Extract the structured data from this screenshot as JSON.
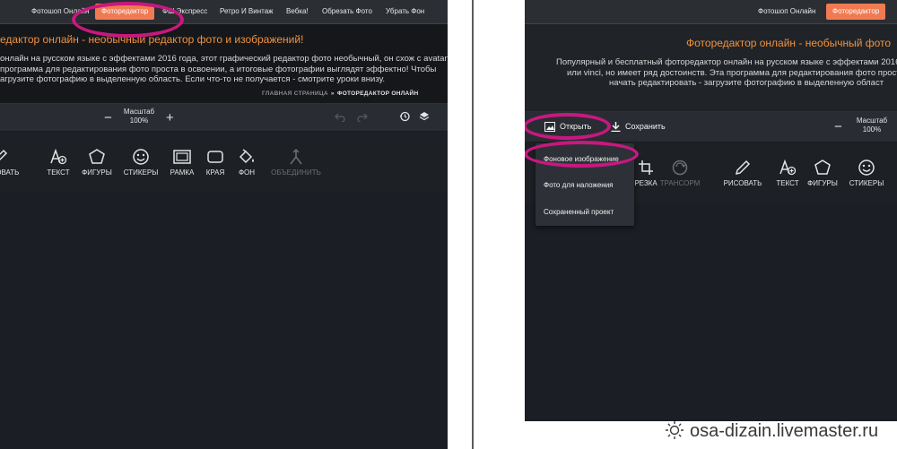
{
  "left": {
    "nav": [
      "Фотошоп Онлайн",
      "Фоторедактор",
      "ФШ Экспресс",
      "Ретро И Винтаж",
      "Вебка!",
      "Обрезать Фото",
      "Убрать Фон"
    ],
    "hero": {
      "title": "едактор онлайн - необычный редактор фото и изображений!",
      "lines": [
        "онлайн на русском языке с эффектами 2016 года, этот графический редактор фото необычный, он схож с avatan",
        "программа для редактирования фото проста в освоении, а итоговые фотографии выглядят эффектно! Чтобы",
        "агрузите фотографию в выделенную область. Если что-то не получается - смотрите уроки внизу."
      ],
      "crumb_home": "ГЛАВНАЯ СТРАНИЦА",
      "crumb_sep": "»",
      "crumb_current": "ФОТОРЕДАКТОР ОНЛАЙН"
    },
    "toolbar": {
      "zoom_title": "Масштаб",
      "zoom_value": "100%",
      "minus": "−",
      "plus": "+"
    },
    "tools": [
      "РИСОВАТЬ",
      "ТЕКСТ",
      "ФИГУРЫ",
      "СТИКЕРЫ",
      "РАМКА",
      "КРАЯ",
      "ФОН",
      "ОБЪЕДИНИТЬ"
    ]
  },
  "right": {
    "nav": [
      "Фотошоп Онлайн",
      "Фоторедактор"
    ],
    "hero": {
      "title": "Фоторедактор онлайн - необычный фото",
      "lines": [
        "Популярный и бесплатный фоторедактор онлайн на русском языке с эффектами 2016",
        "или vinci, но имеет ряд достоинств. Эта программа для редактирования фото проста",
        "начать редактировать - загрузите фотографию в выделенную област"
      ]
    },
    "toolbar": {
      "open": "Открыть",
      "save": "Сохранить",
      "zoom_title": "Масштаб",
      "zoom_value": "100%",
      "minus": "−"
    },
    "tools": [
      "РЕЗКА",
      "ТРАНСОРМ",
      "РИСОВАТЬ",
      "ТЕКСТ",
      "ФИГУРЫ",
      "СТИКЕРЫ"
    ],
    "dropdown": [
      "Фоновое изображение",
      "Фото для наложения",
      "Сохраненный проект"
    ]
  },
  "watermark": "osa-dizain.livemaster.ru",
  "colors": {
    "accent": "#f07a52",
    "title": "#f0923e",
    "highlight": "#c8187f",
    "bg": "#1b1e24",
    "toolbar": "#292d33"
  }
}
